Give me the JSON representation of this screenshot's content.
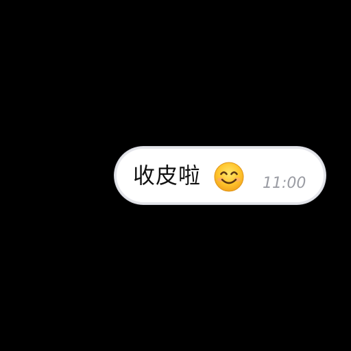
{
  "message": {
    "text": "收皮啦",
    "emoji": "smiling-face-icon",
    "time": "11:00"
  },
  "colors": {
    "background": "#000000",
    "bubble": "#ffffff",
    "text": "#111111",
    "time": "#9a9ca3"
  }
}
